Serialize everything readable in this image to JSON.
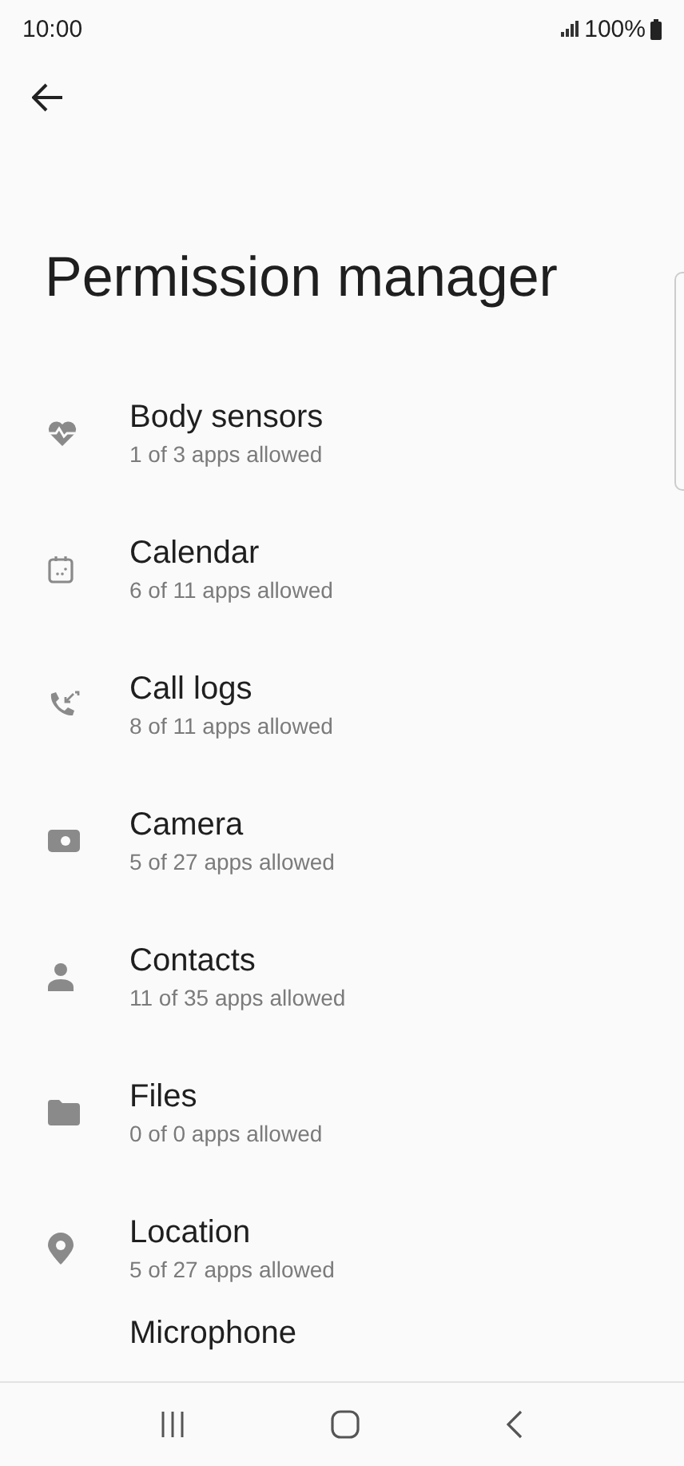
{
  "status_bar": {
    "time": "10:00",
    "battery": "100%"
  },
  "title": "Permission manager",
  "permissions": [
    {
      "kind": "body-sensors",
      "name": "Body sensors",
      "summary": "1 of 3 apps allowed"
    },
    {
      "kind": "calendar",
      "name": "Calendar",
      "summary": "6 of 11 apps allowed"
    },
    {
      "kind": "call-logs",
      "name": "Call logs",
      "summary": "8 of 11 apps allowed"
    },
    {
      "kind": "camera",
      "name": "Camera",
      "summary": "5 of 27 apps allowed"
    },
    {
      "kind": "contacts",
      "name": "Contacts",
      "summary": "11 of 35 apps allowed"
    },
    {
      "kind": "files",
      "name": "Files",
      "summary": "0 of 0 apps allowed"
    },
    {
      "kind": "location",
      "name": "Location",
      "summary": "5 of 27 apps allowed"
    },
    {
      "kind": "microphone",
      "name": "Microphone"
    }
  ]
}
